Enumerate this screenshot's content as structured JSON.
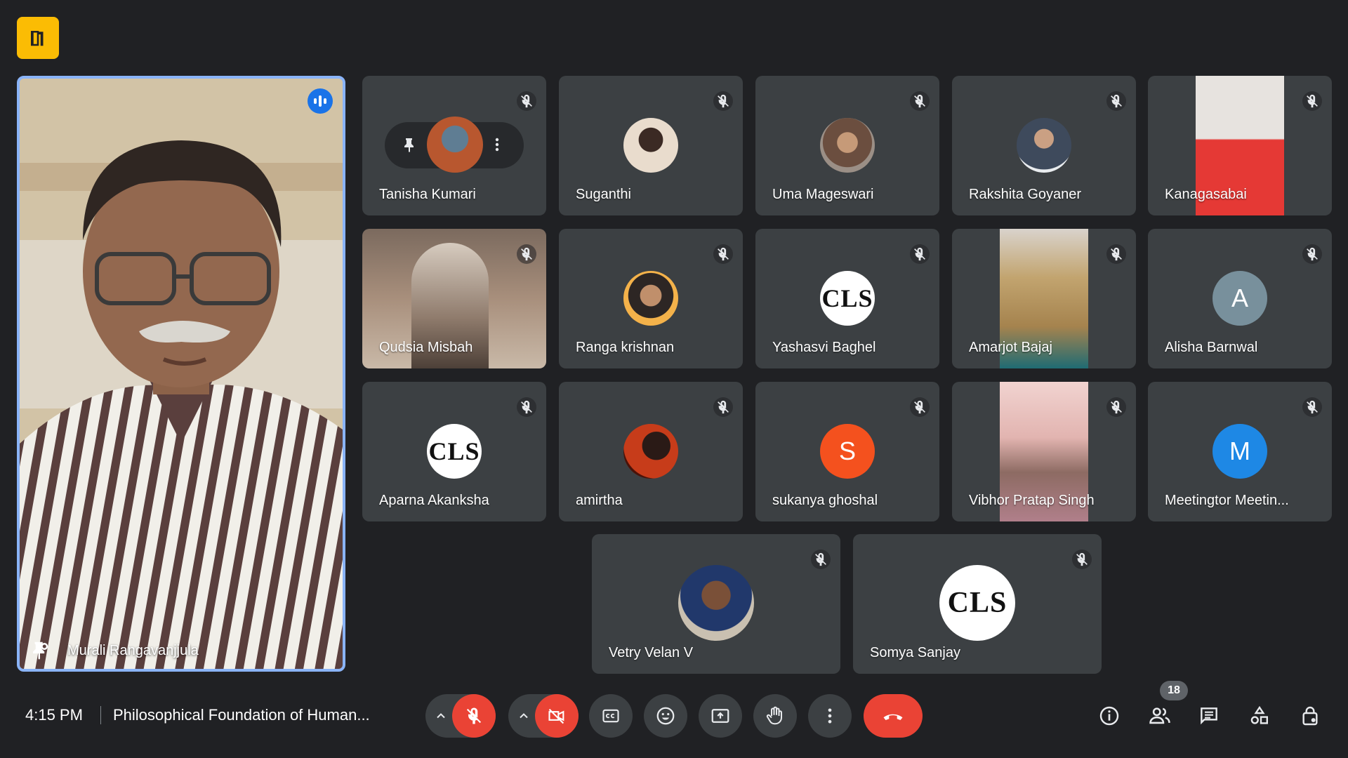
{
  "meeting": {
    "time": "4:15 PM",
    "title": "Philosophical Foundation of Human..."
  },
  "speaker": {
    "name": "Murali Rangavanjjula"
  },
  "participants": [
    {
      "name": "Tanisha Kumari",
      "avatar": "photo"
    },
    {
      "name": "Suganthi",
      "avatar": "photo"
    },
    {
      "name": "Uma Mageswari",
      "avatar": "photo"
    },
    {
      "name": "Rakshita Goyaner",
      "avatar": "photo"
    },
    {
      "name": "Kanagasabai",
      "avatar": "video"
    },
    {
      "name": "Qudsia Misbah",
      "avatar": "video"
    },
    {
      "name": "Ranga krishnan",
      "avatar": "photo"
    },
    {
      "name": "Yashasvi Baghel",
      "avatar": "CLS"
    },
    {
      "name": "Amarjot Bajaj",
      "avatar": "video"
    },
    {
      "name": "Alisha Barnwal",
      "avatar": "A",
      "color": "#78909c"
    },
    {
      "name": "Aparna Akanksha",
      "avatar": "CLS"
    },
    {
      "name": "amirtha",
      "avatar": "photo"
    },
    {
      "name": "sukanya ghoshal",
      "avatar": "S",
      "color": "#f4511e"
    },
    {
      "name": "Vibhor Pratap Singh",
      "avatar": "video"
    },
    {
      "name": "Meetingtor Meetin...",
      "avatar": "M",
      "color": "#1e88e5"
    },
    {
      "name": "Vetry Velan V",
      "avatar": "photo"
    },
    {
      "name": "Somya Sanjay",
      "avatar": "CLS"
    }
  ],
  "logos": {
    "cls": "CLS"
  },
  "people_count": "18",
  "colors": {
    "accent": "#8ab4f8",
    "danger": "#ea4335",
    "tile": "#3c4043",
    "background": "#202124"
  },
  "icons": [
    "mic-off-icon",
    "camera-off-icon",
    "captions-icon",
    "emoji-icon",
    "present-icon",
    "raise-hand-icon",
    "more-options-icon",
    "end-call-icon",
    "info-icon",
    "people-icon",
    "chat-icon",
    "activities-icon",
    "host-controls-icon"
  ]
}
